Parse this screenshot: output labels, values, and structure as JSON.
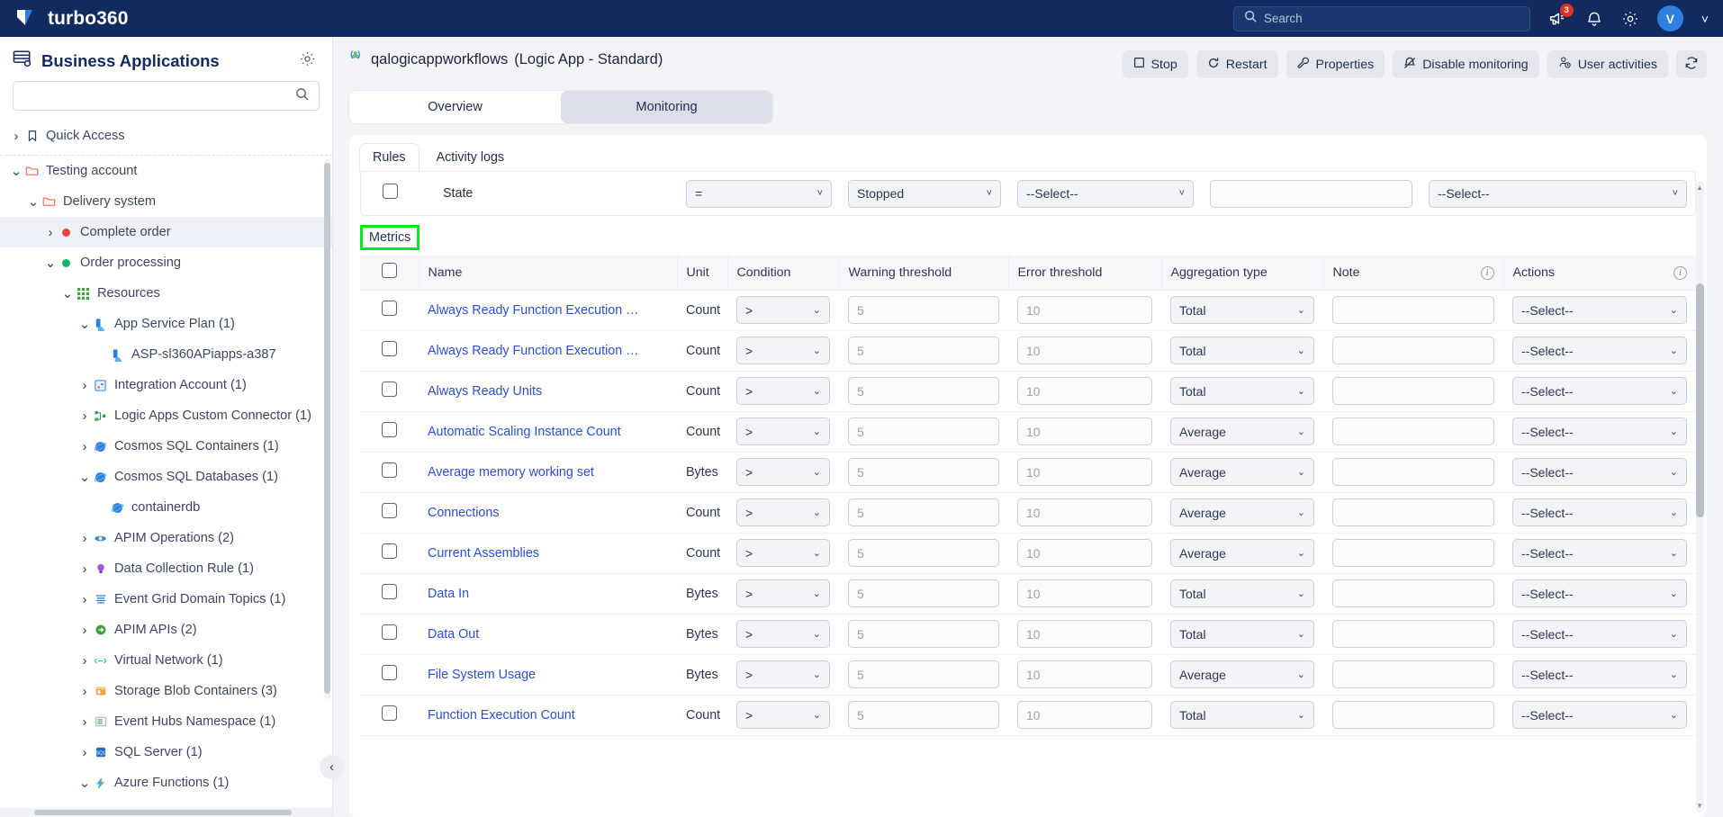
{
  "navbar": {
    "brand": "turbo360",
    "search_placeholder": "Search",
    "announcement_badge": "3",
    "avatar_initial": "V",
    "icons": [
      "megaphone-icon",
      "bell-icon",
      "gear-icon"
    ]
  },
  "sidebar": {
    "title": "Business Applications",
    "search_placeholder": "",
    "items": [
      {
        "label": "Quick Access",
        "depth": 0,
        "chevron": "right",
        "icon": "bookmark-icon",
        "selected": false
      },
      {
        "label": "Testing account",
        "depth": 0,
        "chevron": "down",
        "icon": "folder-icon",
        "selected": false
      },
      {
        "label": "Delivery system",
        "depth": 1,
        "chevron": "down",
        "icon": "folder-icon",
        "selected": false
      },
      {
        "label": "Complete order",
        "depth": 2,
        "chevron": "right",
        "icon": "red-dot",
        "selected": true
      },
      {
        "label": "Order processing",
        "depth": 2,
        "chevron": "down",
        "icon": "green-dot",
        "selected": false
      },
      {
        "label": "Resources",
        "depth": 3,
        "chevron": "down",
        "icon": "grid-icon",
        "selected": false
      },
      {
        "label": "App Service Plan (1)",
        "depth": 4,
        "chevron": "down",
        "icon": "app-service-plan-icon",
        "selected": false
      },
      {
        "label": "ASP-sl360APiapps-a387",
        "depth": 5,
        "chevron": "none",
        "icon": "app-service-plan-icon",
        "selected": false
      },
      {
        "label": "Integration Account (1)",
        "depth": 4,
        "chevron": "right",
        "icon": "integration-account-icon",
        "selected": false
      },
      {
        "label": "Logic Apps Custom Connector (1)",
        "depth": 4,
        "chevron": "right",
        "icon": "custom-connector-icon",
        "selected": false
      },
      {
        "label": "Cosmos SQL Containers (1)",
        "depth": 4,
        "chevron": "right",
        "icon": "cosmos-db-icon",
        "selected": false
      },
      {
        "label": "Cosmos SQL Databases (1)",
        "depth": 4,
        "chevron": "down",
        "icon": "cosmos-db-icon",
        "selected": false
      },
      {
        "label": "containerdb",
        "depth": 5,
        "chevron": "none",
        "icon": "cosmos-db-icon",
        "selected": false
      },
      {
        "label": "APIM Operations (2)",
        "depth": 4,
        "chevron": "right",
        "icon": "apim-operations-icon",
        "selected": false
      },
      {
        "label": "Data Collection Rule (1)",
        "depth": 4,
        "chevron": "right",
        "icon": "data-collection-rule-icon",
        "selected": false
      },
      {
        "label": "Event Grid Domain Topics (1)",
        "depth": 4,
        "chevron": "right",
        "icon": "event-grid-icon",
        "selected": false
      },
      {
        "label": "APIM APIs (2)",
        "depth": 4,
        "chevron": "right",
        "icon": "apim-apis-icon",
        "selected": false
      },
      {
        "label": "Virtual Network (1)",
        "depth": 4,
        "chevron": "right",
        "icon": "virtual-network-icon",
        "selected": false
      },
      {
        "label": "Storage Blob Containers (3)",
        "depth": 4,
        "chevron": "right",
        "icon": "storage-blob-icon",
        "selected": false
      },
      {
        "label": "Event Hubs Namespace (1)",
        "depth": 4,
        "chevron": "right",
        "icon": "event-hubs-icon",
        "selected": false
      },
      {
        "label": "SQL Server (1)",
        "depth": 4,
        "chevron": "right",
        "icon": "sql-server-icon",
        "selected": false
      },
      {
        "label": "Azure Functions (1)",
        "depth": 4,
        "chevron": "down",
        "icon": "azure-functions-icon",
        "selected": false
      }
    ]
  },
  "main": {
    "resource_name": "qalogicappworkflows",
    "resource_type": "(Logic App - Standard)",
    "toolbar": [
      {
        "label": "Stop",
        "icon": "stop-icon"
      },
      {
        "label": "Restart",
        "icon": "restart-icon"
      },
      {
        "label": "Properties",
        "icon": "wrench-icon"
      },
      {
        "label": "Disable monitoring",
        "icon": "disable-monitoring-icon"
      },
      {
        "label": "User activities",
        "icon": "user-activities-icon"
      }
    ],
    "refresh_icon": "refresh-icon",
    "tabs": [
      {
        "label": "Overview",
        "active": false
      },
      {
        "label": "Monitoring",
        "active": true
      }
    ],
    "subtabs": [
      {
        "label": "Rules",
        "active": true
      },
      {
        "label": "Activity logs",
        "active": false
      }
    ],
    "state_filter": {
      "name": "State",
      "condition": "=",
      "value": "Stopped",
      "aggregation": "--Select--",
      "note": "",
      "action": "--Select--"
    },
    "section_label": "Metrics",
    "table": {
      "columns": [
        "",
        "Name",
        "Unit",
        "Condition",
        "Warning threshold",
        "Error threshold",
        "Aggregation type",
        "Note",
        "Actions"
      ],
      "note_info_icon": "info-icon",
      "actions_info_icon": "info-icon",
      "warning_placeholder": "5",
      "error_placeholder": "10",
      "note_placeholder": "",
      "rows": [
        {
          "name": "Always Ready Function Execution …",
          "unit": "Count",
          "condition": ">",
          "warning": "5",
          "error": "10",
          "aggregation": "Total",
          "note": "",
          "action": "--Select--"
        },
        {
          "name": "Always Ready Function Execution …",
          "unit": "Count",
          "condition": ">",
          "warning": "5",
          "error": "10",
          "aggregation": "Total",
          "note": "",
          "action": "--Select--"
        },
        {
          "name": "Always Ready Units",
          "unit": "Count",
          "condition": ">",
          "warning": "5",
          "error": "10",
          "aggregation": "Total",
          "note": "",
          "action": "--Select--"
        },
        {
          "name": "Automatic Scaling Instance Count",
          "unit": "Count",
          "condition": ">",
          "warning": "5",
          "error": "10",
          "aggregation": "Average",
          "note": "",
          "action": "--Select--"
        },
        {
          "name": "Average memory working set",
          "unit": "Bytes",
          "condition": ">",
          "warning": "5",
          "error": "10",
          "aggregation": "Average",
          "note": "",
          "action": "--Select--"
        },
        {
          "name": "Connections",
          "unit": "Count",
          "condition": ">",
          "warning": "5",
          "error": "10",
          "aggregation": "Average",
          "note": "",
          "action": "--Select--"
        },
        {
          "name": "Current Assemblies",
          "unit": "Count",
          "condition": ">",
          "warning": "5",
          "error": "10",
          "aggregation": "Average",
          "note": "",
          "action": "--Select--"
        },
        {
          "name": "Data In",
          "unit": "Bytes",
          "condition": ">",
          "warning": "5",
          "error": "10",
          "aggregation": "Total",
          "note": "",
          "action": "--Select--"
        },
        {
          "name": "Data Out",
          "unit": "Bytes",
          "condition": ">",
          "warning": "5",
          "error": "10",
          "aggregation": "Total",
          "note": "",
          "action": "--Select--"
        },
        {
          "name": "File System Usage",
          "unit": "Bytes",
          "condition": ">",
          "warning": "5",
          "error": "10",
          "aggregation": "Average",
          "note": "",
          "action": "--Select--"
        },
        {
          "name": "Function Execution Count",
          "unit": "Count",
          "condition": ">",
          "warning": "5",
          "error": "10",
          "aggregation": "Total",
          "note": "",
          "action": "--Select--"
        }
      ]
    }
  },
  "colors": {
    "navbar": "#122a5e",
    "accent_link": "#2b4ed1",
    "highlight": "#00e81e",
    "badge": "#e03127"
  }
}
